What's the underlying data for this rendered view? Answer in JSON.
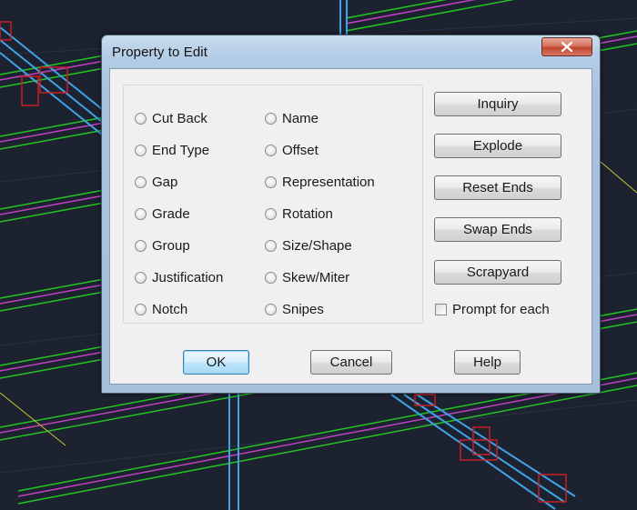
{
  "dialog": {
    "title": "Property to Edit",
    "close_icon": "close-x-icon",
    "options_col1": [
      "Cut Back",
      "End Type",
      "Gap",
      "Grade",
      "Group",
      "Justification",
      "Notch"
    ],
    "options_col2": [
      "Name",
      "Offset",
      "Representation",
      "Rotation",
      "Size/Shape",
      "Skew/Miter",
      "Snipes"
    ],
    "actions": [
      "Inquiry",
      "Explode",
      "Reset Ends",
      "Swap Ends",
      "Scrapyard"
    ],
    "prompt_for_each": {
      "label": "Prompt for each",
      "checked": false
    },
    "buttons": {
      "ok": "OK",
      "cancel": "Cancel",
      "help": "Help"
    }
  },
  "colors": {
    "cad_background": "#1d2230",
    "beam_green": "#22c422",
    "beam_magenta": "#c040c0",
    "beam_cyan": "#3fa3e8",
    "member_red": "#c81e28"
  }
}
